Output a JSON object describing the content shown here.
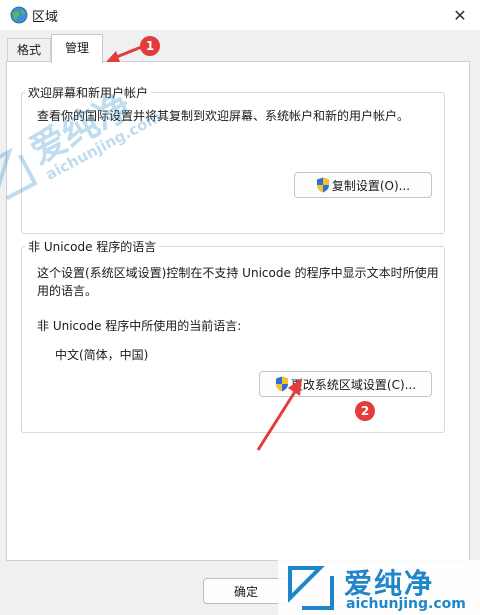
{
  "window": {
    "title": "区域",
    "icon": "globe-icon",
    "close_symbol": "✕"
  },
  "tabs": [
    {
      "label": "格式",
      "active": false
    },
    {
      "label": "管理",
      "active": true
    }
  ],
  "welcome_group": {
    "legend": "欢迎屏幕和新用户帐户",
    "description": "查看你的国际设置并将其复制到欢迎屏幕、系统帐户和新的用户帐户。",
    "copy_button": "复制设置(O)..."
  },
  "non_unicode_group": {
    "legend": "非 Unicode 程序的语言",
    "description_line1": "这个设置(系统区域设置)控制在不支持 Unicode 的程序中显示文本时所使用",
    "description_line2": "用的语言。",
    "current_label": "非 Unicode 程序中所使用的当前语言:",
    "current_value": "中文(简体，中国)",
    "change_button": "更改系统区域设置(C)..."
  },
  "footer": {
    "ok_button": "确定"
  },
  "annotations": {
    "marker1": "1",
    "marker2": "2",
    "color": "#e23c3c"
  },
  "watermark": {
    "brand": "爱纯净",
    "url": "aichunjing.com",
    "color": "#1f86c9"
  }
}
